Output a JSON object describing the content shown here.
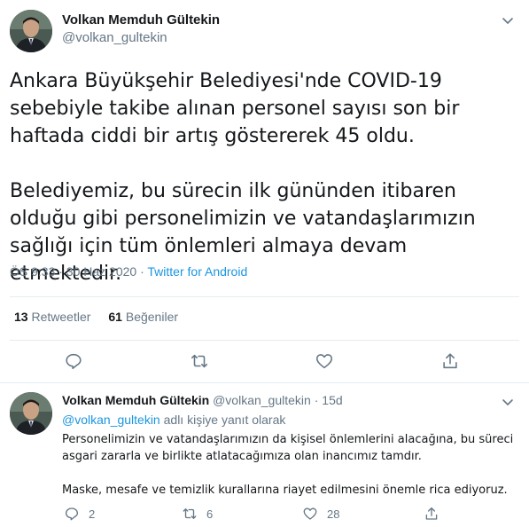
{
  "main_tweet": {
    "author_name": "Volkan Memduh Gültekin",
    "author_handle": "@volkan_gultekin",
    "paragraphs": [
      "Ankara Büyükşehir Belediyesi'nde COVID-19 sebebiyle takibe alınan personel sayısı son bir haftada ciddi bir artış göstererek 45 oldu.",
      "Belediyemiz, bu sürecin ilk gününden itibaren olduğu gibi personelimizin ve vatandaşlarımızın sağlığı için tüm önlemleri almaya devam etmektedir."
    ],
    "timestamp": "ÖS 9:33 · 30 Haz 2020 ·",
    "source": "Twitter for Android",
    "retweet_count": "13",
    "retweet_label": "Retweetler",
    "like_count": "61",
    "like_label": "Beğeniler",
    "actions": [
      "reply-icon",
      "retweet-icon",
      "like-icon",
      "share-icon"
    ]
  },
  "reply_tweet": {
    "author_name": "Volkan Memduh Gültekin",
    "author_handle": "@volkan_gultekin",
    "separator": "·",
    "age": "15d",
    "reply_to_handle": "@volkan_gultekin",
    "reply_to_suffix": "adlı kişiye yanıt olarak",
    "paragraphs": [
      "Personelimizin ve vatandaşlarımızın da kişisel önlemlerini alacağına, bu süreci asgari zararla ve birlikte atlatacağımıza olan inancımız tamdır.",
      "Maske, mesafe ve temizlik kurallarına riayet edilmesini önemle rica ediyoruz."
    ],
    "reply_count": "2",
    "retweet_count": "6",
    "like_count": "28"
  },
  "colors": {
    "text": "#14171a",
    "muted": "#657786",
    "link": "#1b95e0",
    "border": "#e6ecf0"
  }
}
